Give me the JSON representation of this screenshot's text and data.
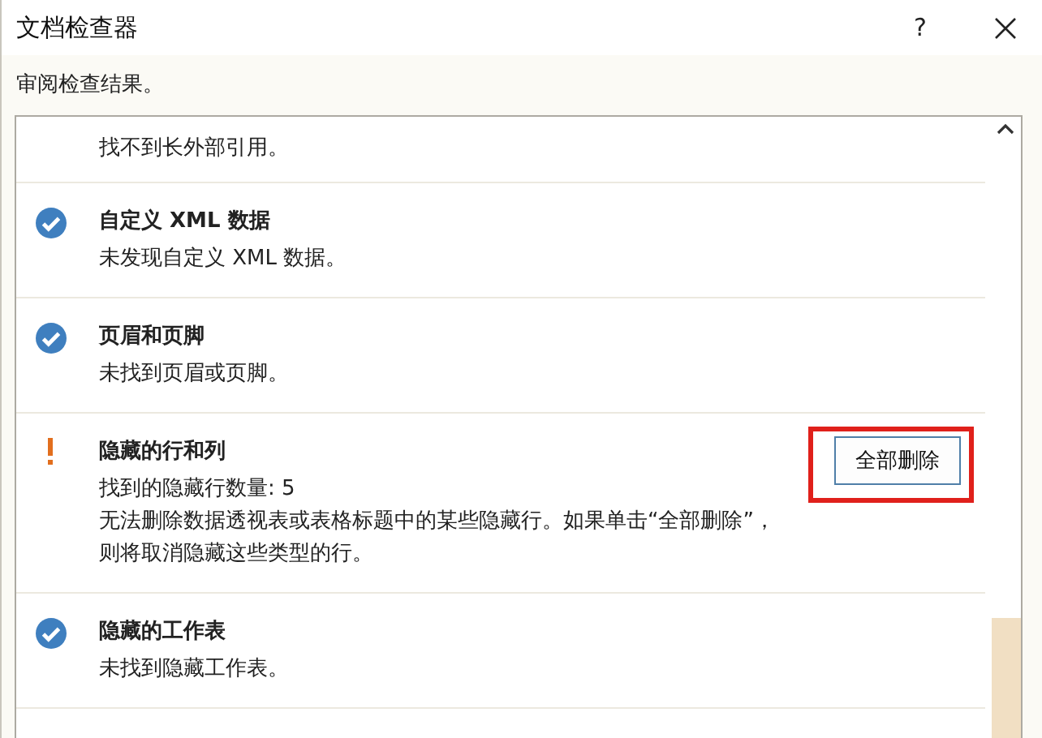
{
  "window": {
    "title": "文档检查器",
    "help": "?"
  },
  "subtitle": "审阅检查结果。",
  "results": [
    {
      "kind": "plain",
      "lines": [
        "找不到长外部引用。"
      ]
    },
    {
      "kind": "ok",
      "heading": "自定义 XML 数据",
      "lines": [
        "未发现自定义 XML 数据。"
      ]
    },
    {
      "kind": "ok",
      "heading": "页眉和页脚",
      "lines": [
        "未找到页眉或页脚。"
      ]
    },
    {
      "kind": "warning",
      "heading": "隐藏的行和列",
      "lines": [
        "找到的隐藏行数量: 5",
        "无法删除数据透视表或表格标题中的某些隐藏行。如果单击“全部删除”，",
        "则将取消隐藏这些类型的行。"
      ],
      "action": {
        "label": "全部删除",
        "highlighted": true
      }
    },
    {
      "kind": "ok",
      "heading": "隐藏的工作表",
      "lines": [
        "未找到隐藏工作表。"
      ]
    }
  ]
}
